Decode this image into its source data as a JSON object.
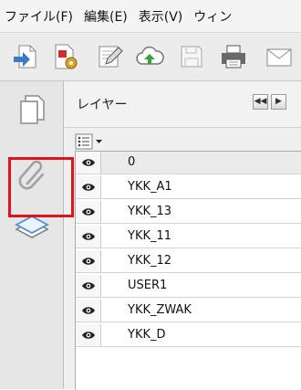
{
  "menubar": {
    "items": [
      "ファイル(F)",
      "編集(E)",
      "表示(V)",
      "ウィン"
    ]
  },
  "toolbar": {
    "icons": [
      "open-file-icon",
      "create-pdf-icon",
      "edit-icon",
      "cloud-upload-icon",
      "save-icon",
      "print-icon",
      "email-icon"
    ]
  },
  "navpanel": {
    "buttons": [
      "pages-icon",
      "attachments-icon",
      "layers-icon"
    ]
  },
  "layers_panel": {
    "title": "レイヤー",
    "nav_prev": "◀◀",
    "nav_next": "▶",
    "layers": [
      "0",
      "YKK_A1",
      "YKK_13",
      "YKK_11",
      "YKK_12",
      "USER1",
      "YKK_ZWAK",
      "YKK_D"
    ]
  },
  "colors": {
    "highlight": "#e0131a",
    "selected_row": "#ebebeb"
  }
}
